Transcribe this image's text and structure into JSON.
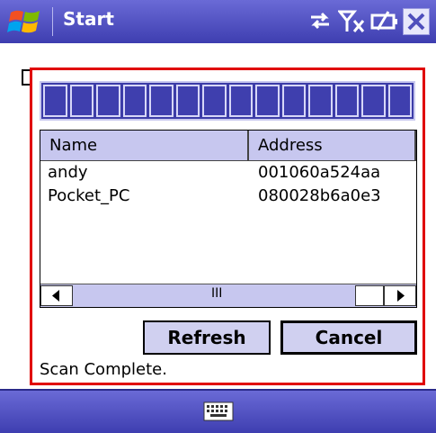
{
  "titlebar": {
    "title": "Start",
    "icons": [
      "windows-flag-icon",
      "connectivity-icon",
      "signal-off-icon",
      "battery-icon",
      "close-icon"
    ]
  },
  "dialog": {
    "progress": {
      "segments": 14,
      "filled": 14
    },
    "list": {
      "columns": [
        "Name",
        "Address"
      ],
      "rows": [
        {
          "name": "andy",
          "address": "001060a524aa"
        },
        {
          "name": "Pocket_PC",
          "address": "080028b6a0e3"
        }
      ]
    },
    "scrollbar": {
      "grip": "III"
    },
    "buttons": {
      "refresh": "Refresh",
      "cancel": "Cancel"
    },
    "status": "Scan Complete."
  },
  "bottombar": {
    "icon": "keyboard-icon"
  }
}
